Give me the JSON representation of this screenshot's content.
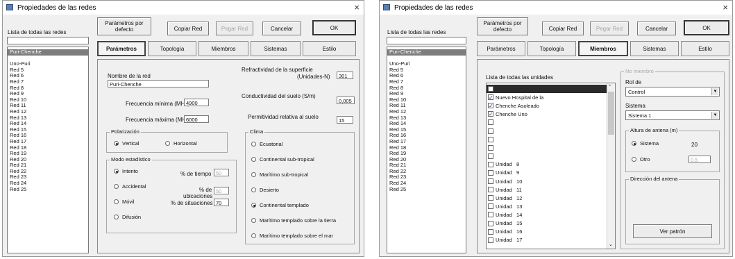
{
  "left": {
    "title": "Propiedades de las redes",
    "close": "×",
    "list_label": "Lista de todas las redes",
    "list": [
      "Puri-Chenche",
      "",
      "Uno-Puri",
      "Red 5",
      "Red 6",
      "Red 7",
      "Red 8",
      "Red 9",
      "Red 10",
      "Red 11",
      "Red 12",
      "Red 13",
      "Red 14",
      "Red 15",
      "Red 16",
      "Red 17",
      "Red 18",
      "Red 19",
      "Red 20",
      "Red 21",
      "Red 22",
      "Red 23",
      "Red 24",
      "Red 25"
    ],
    "buttons": {
      "defaults": "Parámetros por defecto",
      "copy": "Copiar Red",
      "paste": "Pegar Red",
      "cancel": "Cancelar",
      "ok": "OK"
    },
    "tabs": [
      "Parámetros",
      "Topología",
      "Miembros",
      "Sistemas",
      "Estilo"
    ],
    "params": {
      "net_name_label": "Nombre de la red",
      "net_name": "Puri-Chenche",
      "fmin_label": "Frecuencia mínima (MHz)",
      "fmin": "4900",
      "fmax_label": "Frecuencia máxima (MHz)",
      "fmax": "6000",
      "refr_label_1": "Refractividad de la superficie",
      "refr_label_2": "(Unidades-N)",
      "refr": "301",
      "cond_label": "Conductividad del suelo (S/m)",
      "cond": "0,005",
      "perm_label": "Permitividad relativa al suelo",
      "perm": "15",
      "pol_title": "Polarización",
      "pol_vertical": "Vertical",
      "pol_horizontal": "Horizontal",
      "mode_title": "Modo estadístico",
      "mode_intento": "Intento",
      "mode_accidental": "Accidental",
      "mode_movil": "Móvil",
      "mode_difusion": "Difusión",
      "time_label": "% de tiempo",
      "time": "50",
      "loc_label_1": "% de",
      "loc_label_2": "ubicaciones",
      "loc": "50",
      "sit_label": "% de situaciones",
      "sit": "70",
      "clima_title": "Clima",
      "clima": [
        "Ecuatorial",
        "Continental sub-tropical",
        "Marítimo sub-tropical",
        "Desierto",
        "Continental templado",
        "Marítimo templado sobre la tierra",
        "Marítimo templado sobre el mar"
      ],
      "clima_selected": 4
    }
  },
  "right": {
    "title": "Propiedades de las redes",
    "close": "×",
    "list_label": "Lista de todas las redes",
    "list": [
      "Puri-Chenche",
      "",
      "Uno-Puri",
      "Red 5",
      "Red 6",
      "Red 7",
      "Red 8",
      "Red 9",
      "Red 10",
      "Red 11",
      "Red 12",
      "Red 13",
      "Red 14",
      "Red 15",
      "Red 16",
      "Red 17",
      "Red 18",
      "Red 19",
      "Red 20",
      "Red 21",
      "Red 22",
      "Red 23",
      "Red 24",
      "Red 25"
    ],
    "buttons": {
      "defaults": "Parámetros por defecto",
      "copy": "Copiar Red",
      "paste": "Pegar Red",
      "cancel": "Cancelar",
      "ok": "OK"
    },
    "tabs": [
      "Parámetros",
      "Topología",
      "Miembros",
      "Sistemas",
      "Estilo"
    ],
    "members": {
      "units_label": "Lista de todas las unidades",
      "units": [
        {
          "label": "",
          "checked": false,
          "selected": true
        },
        {
          "label": "Nuevo Hospital de la",
          "checked": true
        },
        {
          "label": "Chenche Asoleado",
          "checked": true
        },
        {
          "label": "Chenche Uno",
          "checked": true
        },
        {
          "label": "",
          "checked": false
        },
        {
          "label": "",
          "checked": false
        },
        {
          "label": "",
          "checked": false
        },
        {
          "label": "",
          "checked": false
        },
        {
          "label": "",
          "checked": false
        },
        {
          "label": "Unidad   8",
          "checked": false
        },
        {
          "label": "Unidad   9",
          "checked": false
        },
        {
          "label": "Unidad   10",
          "checked": false
        },
        {
          "label": "Unidad   11",
          "checked": false
        },
        {
          "label": "Unidad   12",
          "checked": false
        },
        {
          "label": "Unidad   13",
          "checked": false
        },
        {
          "label": "Unidad   14",
          "checked": false
        },
        {
          "label": "Unidad   15",
          "checked": false
        },
        {
          "label": "Unidad   16",
          "checked": false
        },
        {
          "label": "Unidad   17",
          "checked": false
        }
      ],
      "no_member": "No miembro",
      "role_label": "Rol de",
      "role": "Control",
      "system_label": "Sistema",
      "system": "Sistema   1",
      "antenna_title": "Altura de antena (m)",
      "ant_sistema": "Sistema",
      "ant_sistema_value": "20",
      "ant_otro": "Otro",
      "ant_otro_value": "0.5",
      "direction_title": "Dirección del antena",
      "pattern_button": "Ver patrón"
    }
  }
}
